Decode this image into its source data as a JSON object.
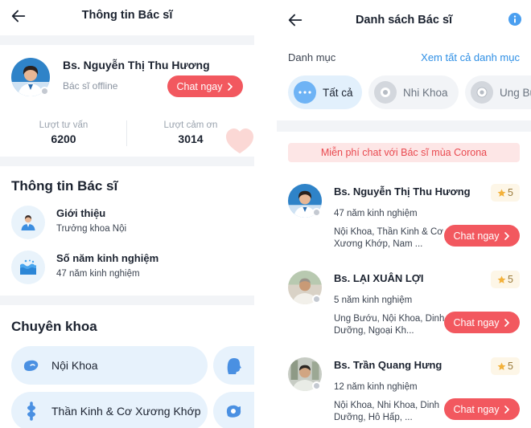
{
  "profile_screen": {
    "title": "Thông tin Bác sĩ",
    "doctor_name": "Bs. Nguyễn Thị Thu Hương",
    "status": "Bác sĩ offline",
    "chat_label": "Chat ngay",
    "stats": [
      {
        "label": "Lượt tư vấn",
        "value": "6200"
      },
      {
        "label": "Lượt cảm ơn",
        "value": "3014"
      }
    ],
    "info_section_title": "Thông tin Bác sĩ",
    "intro": {
      "title": "Giới thiệu",
      "value": "Trưởng khoa Nội"
    },
    "experience": {
      "title": "Số năm kinh nghiệm",
      "value": "47 năm kinh nghiệm"
    },
    "specialty_section_title": "Chuyên khoa",
    "specialties": [
      "Nội Khoa",
      "Thần Kinh & Cơ Xương Khớp"
    ],
    "icons": {
      "back": "arrow-left-icon",
      "intro": "doctor-person-icon",
      "experience": "water-wave-icon"
    }
  },
  "list_screen": {
    "title": "Danh sách Bác sĩ",
    "category_label": "Danh mục",
    "see_all_label": "Xem tất cả danh mục",
    "categories": [
      {
        "label": "Tất cả",
        "selected": true
      },
      {
        "label": "Nhi Khoa",
        "selected": false
      },
      {
        "label": "Ung Bướu",
        "selected": false
      }
    ],
    "banner": "Miễn phí chat với Bác sĩ mùa Corona",
    "doctors": [
      {
        "name": "Bs. Nguyễn Thị Thu Hương",
        "rating": "5",
        "experience": "47 năm kinh nghiệm",
        "specialties": "Nội Khoa, Thần Kinh & Cơ Xương Khớp, Nam ...",
        "chat_label": "Chat ngay"
      },
      {
        "name": "Bs. LẠI XUÂN LỢI",
        "rating": "5",
        "experience": "5 năm kinh nghiệm",
        "specialties": "Ung Bướu, Nội Khoa, Dinh Dưỡng, Ngoại Kh...",
        "chat_label": "Chat ngay"
      },
      {
        "name": "Bs. Trần Quang Hưng",
        "rating": "5",
        "experience": "12 năm kinh nghiệm",
        "specialties": "Nội Khoa, Nhi Khoa, Dinh Dưỡng, Hô Hấp, ...",
        "chat_label": "Chat ngay"
      }
    ],
    "icons": {
      "back": "arrow-left-icon",
      "info": "info-icon",
      "star": "star-icon"
    }
  },
  "colors": {
    "accent_red": "#f2585f",
    "link_blue": "#2e8fe5",
    "pill_blue": "#e7f2fc",
    "rating_gold": "#f3b13a",
    "banner_bg": "#fde6e6"
  }
}
